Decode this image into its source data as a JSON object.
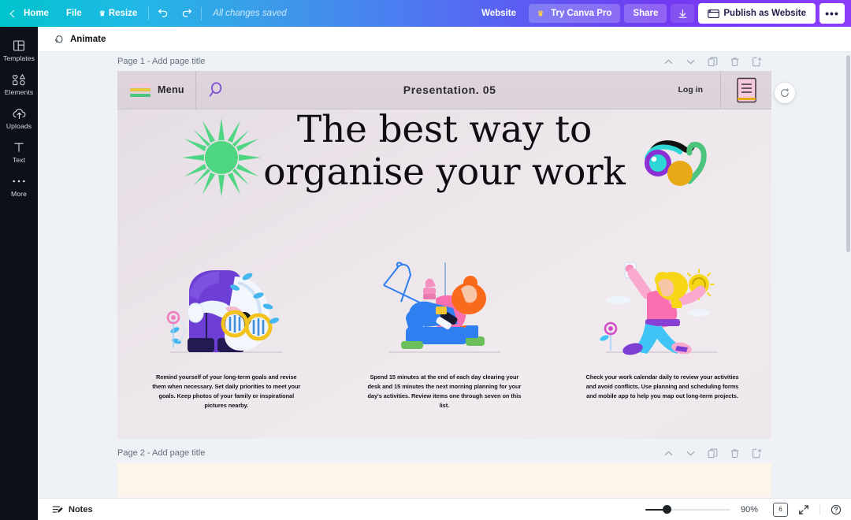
{
  "topbar": {
    "back_label": "Home",
    "file_label": "File",
    "resize_label": "Resize",
    "undo_icon": "undo-icon",
    "redo_icon": "redo-icon",
    "save_status": "All changes saved",
    "website_label": "Website",
    "try_pro_label": "Try Canva Pro",
    "share_label": "Share",
    "download_icon": "download-icon",
    "publish_label": "Publish as Website",
    "more_label": "•••",
    "gradient_start": "#00c4cc",
    "gradient_end": "#8b3dfa"
  },
  "rail": {
    "items": [
      {
        "label": "Templates",
        "icon": "templates-icon"
      },
      {
        "label": "Elements",
        "icon": "elements-icon"
      },
      {
        "label": "Uploads",
        "icon": "uploads-cloud-icon"
      },
      {
        "label": "Text",
        "icon": "text-icon"
      },
      {
        "label": "More",
        "icon": "more-dots-icon"
      }
    ],
    "background": "#0d1019"
  },
  "toolbar": {
    "animate_label": "Animate",
    "animate_icon": "animate-icon"
  },
  "pages": [
    {
      "title": "Page 1 - Add page title",
      "actions": [
        "move-up-icon",
        "move-down-icon",
        "duplicate-icon",
        "delete-icon",
        "add-page-icon"
      ]
    },
    {
      "title": "Page 2 - Add page title",
      "actions": [
        "move-up-icon",
        "move-down-icon",
        "duplicate-icon",
        "delete-icon",
        "add-page-icon"
      ]
    }
  ],
  "slide": {
    "nav": {
      "menu_label": "Menu",
      "search_icon": "magnifier-icon",
      "title": "Presentation. 05",
      "login_label": "Log in",
      "doc_icon": "document-icon"
    },
    "heading_line1": "The best way to",
    "heading_line2": "organise your work",
    "columns": [
      {
        "art": "person-leaning-sunglasses-illustration",
        "text": "Remind yourself of your long-term goals and revise them when necessary.  Set daily priorities to meet your goals.  Keep photos of your family or inspirational pictures nearby."
      },
      {
        "art": "person-sitting-with-dog-illustration",
        "text": "Spend 15 minutes at the end of each day clearing your desk and 15 minutes the next morning planning for your day's activities. Review items one through seven on this list."
      },
      {
        "art": "person-taking-selfie-illustration",
        "text": "Check your work calendar daily to review your activities and avoid conflicts.  Use planning and scheduling forms and mobile app to help you map out long-term projects."
      }
    ],
    "decor": {
      "burst_color": "#4fd683",
      "squiggle_colors": [
        "#8b2fd4",
        "#2fd6d6",
        "#111111",
        "#e8a917",
        "#4cc47d"
      ]
    }
  },
  "canvas": {
    "rotate_icon": "rotate-refresh-icon"
  },
  "bottombar": {
    "notes_label": "Notes",
    "notes_icon": "notes-icon",
    "zoom_value": "90%",
    "page_count": "6",
    "fullscreen_icon": "expand-icon",
    "help_icon": "help-question-icon"
  }
}
